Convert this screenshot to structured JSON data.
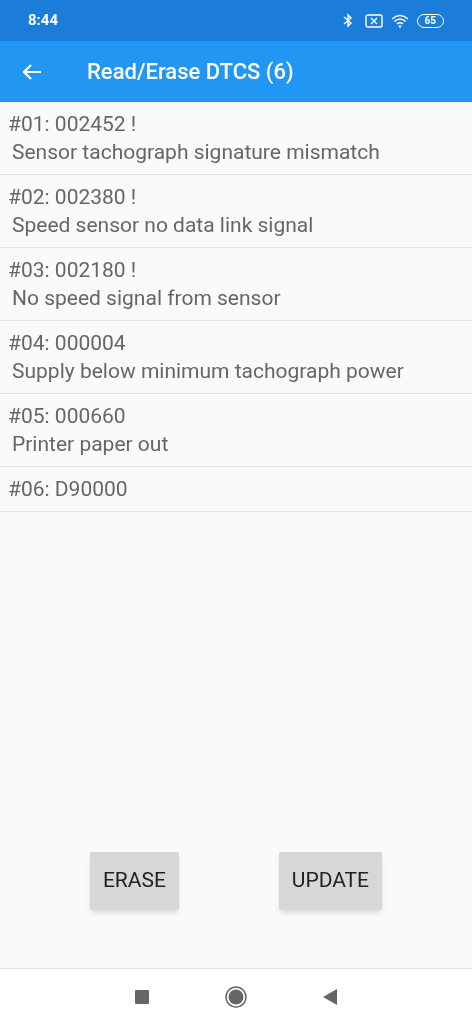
{
  "status_bar": {
    "time": "8:44",
    "battery": "65"
  },
  "app_bar": {
    "title": "Read/Erase DTCS (6)"
  },
  "dtcs": [
    {
      "code": "#01: 002452 !",
      "description": "Sensor tachograph signature mismatch"
    },
    {
      "code": "#02: 002380 !",
      "description": "Speed sensor no data link signal"
    },
    {
      "code": "#03: 002180 !",
      "description": "No speed signal from sensor"
    },
    {
      "code": "#04: 000004",
      "description": "Supply below minimum tachograph power"
    },
    {
      "code": "#05: 000660",
      "description": "Printer paper out"
    },
    {
      "code": "#06: D90000"
    }
  ],
  "buttons": [
    "ERASE",
    "UPDATE"
  ]
}
